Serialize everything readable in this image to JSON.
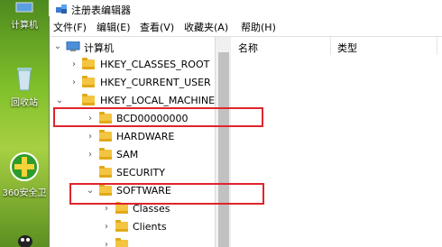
{
  "desktop": {
    "items": [
      {
        "label": "计算机"
      },
      {
        "label": "回收站"
      },
      {
        "label": "360安全卫"
      }
    ]
  },
  "window": {
    "title": "注册表编辑器"
  },
  "menu": [
    "文件(F)",
    "编辑(E)",
    "查看(V)",
    "收藏夹(A)",
    "帮助(H)"
  ],
  "list_columns": [
    "名称",
    "类型"
  ],
  "tree": {
    "root": "计算机",
    "nodes": [
      {
        "label": "HKEY_CLASSES_ROOT"
      },
      {
        "label": "HKEY_CURRENT_USER"
      },
      {
        "label": "HKEY_LOCAL_MACHINE"
      },
      {
        "label": "BCD00000000"
      },
      {
        "label": "HARDWARE"
      },
      {
        "label": "SAM"
      },
      {
        "label": "SECURITY"
      },
      {
        "label": "SOFTWARE"
      },
      {
        "label": "Classes"
      },
      {
        "label": "Clients"
      }
    ]
  },
  "colors": {
    "highlight": "#e0242b",
    "folder": "#f4c542"
  }
}
